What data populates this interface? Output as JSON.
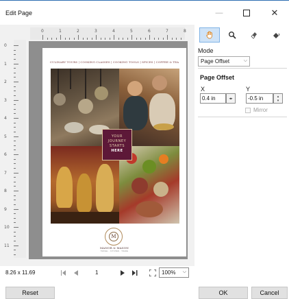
{
  "window": {
    "title": "Edit Page",
    "minimize_glyph": "—",
    "close_glyph": "✕"
  },
  "preview": {
    "ruler_h": [
      "0",
      "1",
      "2",
      "3",
      "4",
      "5",
      "6",
      "7",
      "8"
    ],
    "ruler_v": [
      "0",
      "1",
      "2",
      "3",
      "4",
      "5",
      "6",
      "7",
      "8",
      "9",
      "10",
      "11"
    ],
    "page_header": "CULINARY TOURS | COOKING CLASSES | COOKING TOOLS | SPICES | COFFEE & TEA",
    "badge": [
      "YOUR",
      "JOURNEY",
      "STARTS",
      "HERE"
    ],
    "logo_letter": "M",
    "logo_name": "MANOR & MASON",
    "logo_tagline": "TRAVEL · KITCHEN · TRADE"
  },
  "nav": {
    "page_size": "8.26 x 11.69",
    "page_number": "1",
    "zoom": "100%",
    "icons": {
      "first": "first-page-icon",
      "prev": "previous-page-icon",
      "next": "next-page-icon",
      "last": "last-page-icon",
      "fit": "fit-page-icon"
    }
  },
  "panel": {
    "tools": [
      "hand-tool-icon",
      "zoom-tool-icon",
      "eraser-tool-icon",
      "fill-tool-icon"
    ],
    "mode_label": "Mode",
    "mode_value": "Page Offset",
    "section_title": "Page Offset",
    "x_label": "X",
    "x_value": "0.4 in",
    "y_label": "Y",
    "y_value": "-0.5 in",
    "mirror_label": "Mirror"
  },
  "footer": {
    "reset": "Reset",
    "ok": "OK",
    "cancel": "Cancel"
  },
  "colors": {
    "accent": "#2b6cb0",
    "selected_tool": "#cfe3f7",
    "badge": "#5d1838"
  }
}
